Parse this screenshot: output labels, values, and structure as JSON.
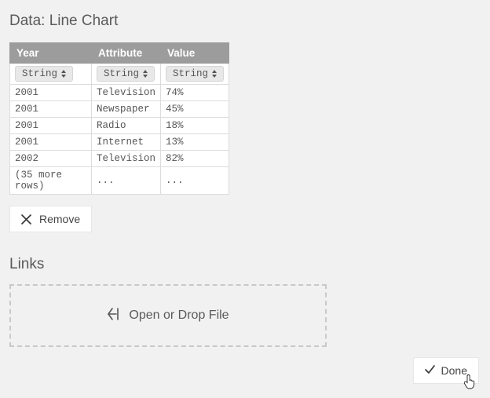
{
  "chart_data": {
    "type": "table",
    "columns": [
      "Year",
      "Attribute",
      "Value"
    ],
    "rows": [
      [
        "2001",
        "Television",
        "74%"
      ],
      [
        "2001",
        "Newspaper",
        "45%"
      ],
      [
        "2001",
        "Radio",
        "18%"
      ],
      [
        "2001",
        "Internet",
        "13%"
      ],
      [
        "2002",
        "Television",
        "82%"
      ]
    ],
    "more_rows_note": "(35 more rows)"
  },
  "header": {
    "title": "Data: Line Chart"
  },
  "table": {
    "headers": {
      "year": "Year",
      "attribute": "Attribute",
      "value": "Value"
    },
    "types": {
      "year": "String",
      "attribute": "String",
      "value": "String"
    },
    "rows": [
      {
        "year": "2001",
        "attribute": "Television",
        "value": "74%"
      },
      {
        "year": "2001",
        "attribute": "Newspaper",
        "value": "45%"
      },
      {
        "year": "2001",
        "attribute": "Radio",
        "value": "18%"
      },
      {
        "year": "2001",
        "attribute": "Internet",
        "value": "13%"
      },
      {
        "year": "2002",
        "attribute": "Television",
        "value": "82%"
      }
    ],
    "more": {
      "label": "(35 more rows)",
      "ellipsis": "..."
    }
  },
  "buttons": {
    "remove": "Remove",
    "done": "Done"
  },
  "links": {
    "title": "Links",
    "dropzone": "Open or Drop File"
  }
}
